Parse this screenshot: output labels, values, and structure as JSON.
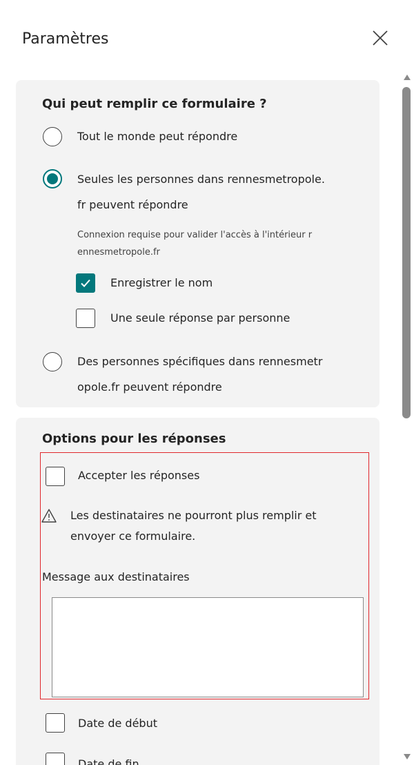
{
  "panel": {
    "title": "Paramètres"
  },
  "who_can_fill": {
    "heading": "Qui peut remplir ce formulaire ?",
    "option_everyone": "Tout le monde peut répondre",
    "option_org_line1": "Seules les personnes dans rennesmetropole.",
    "option_org_line2": "fr peuvent répondre",
    "hint_line1": "Connexion requise pour valider l'accès à l'intérieur r",
    "hint_line2": "ennesmetropole.fr",
    "record_name_label": "Enregistrer le nom",
    "record_name_checked": true,
    "one_response_label": "Une seule réponse par personne",
    "one_response_checked": false,
    "option_specific_line1": "Des personnes spécifiques dans rennesmetr",
    "option_specific_line2": "opole.fr peuvent répondre",
    "selected_option": "org"
  },
  "response_options": {
    "heading": "Options pour les réponses",
    "accept_label": "Accepter les réponses",
    "accept_checked": false,
    "warning_line1": "Les destinataires ne pourront plus remplir et",
    "warning_line2": "envoyer ce formulaire.",
    "message_label": "Message aux destinataires",
    "message_value": "",
    "start_date_label": "Date de début",
    "end_date_label": "Date de fin"
  },
  "colors": {
    "accent": "#03787c",
    "highlight_border": "#e0262b",
    "card_bg": "#f3f3f3"
  },
  "icons": {
    "close": "close-icon",
    "warning": "warning-triangle-icon",
    "check": "checkmark-icon"
  }
}
